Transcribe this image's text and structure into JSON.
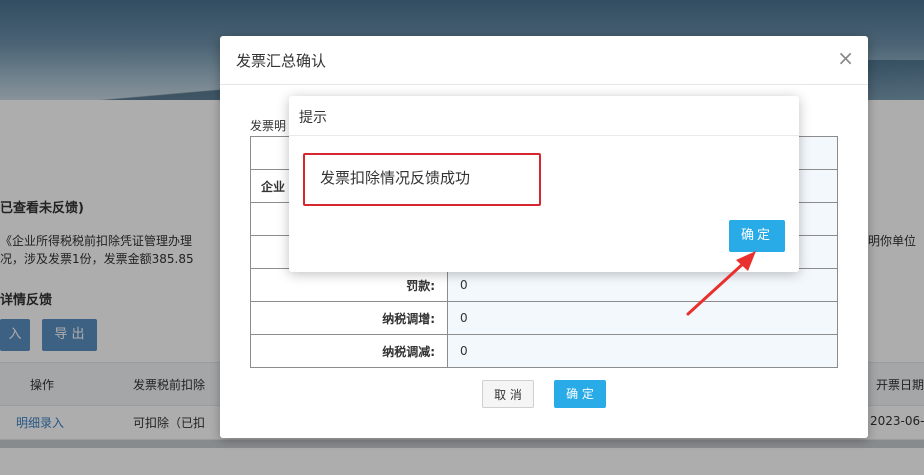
{
  "background": {
    "status_text": "已查看未反馈)",
    "notice_line1": "《企业所得税税前扣除凭证管理办理",
    "notice_line1_right": "明你单位",
    "notice_line2": "况，涉及发票1份，发票金额385.85",
    "section_title": "详情反馈",
    "import_button": "入",
    "export_button": "导 出",
    "table_headers": [
      "操作",
      "发票税前扣除",
      "开票日期"
    ],
    "row": {
      "action_link": "明细录入",
      "deduct_status": "可扣除（已扣",
      "date": "2023-06-"
    }
  },
  "dialog": {
    "title": "发票汇总确认",
    "close_icon": "×",
    "section_label": "发票明",
    "rows": [
      {
        "key": "",
        "value": ""
      },
      {
        "key": "企业",
        "value": ""
      },
      {
        "key": "",
        "value": ""
      },
      {
        "key": "",
        "value": ""
      },
      {
        "key": "罚款:",
        "value": "0"
      },
      {
        "key": "纳税调增:",
        "value": "0"
      },
      {
        "key": "纳税调减:",
        "value": "0"
      }
    ],
    "cancel_label": "取 消",
    "ok_label": "确 定"
  },
  "alert": {
    "title": "提示",
    "message": "发票扣除情况反馈成功",
    "ok_label": "确定"
  },
  "colors": {
    "primary": "#29abe8",
    "highlight_red": "#d8262e"
  }
}
